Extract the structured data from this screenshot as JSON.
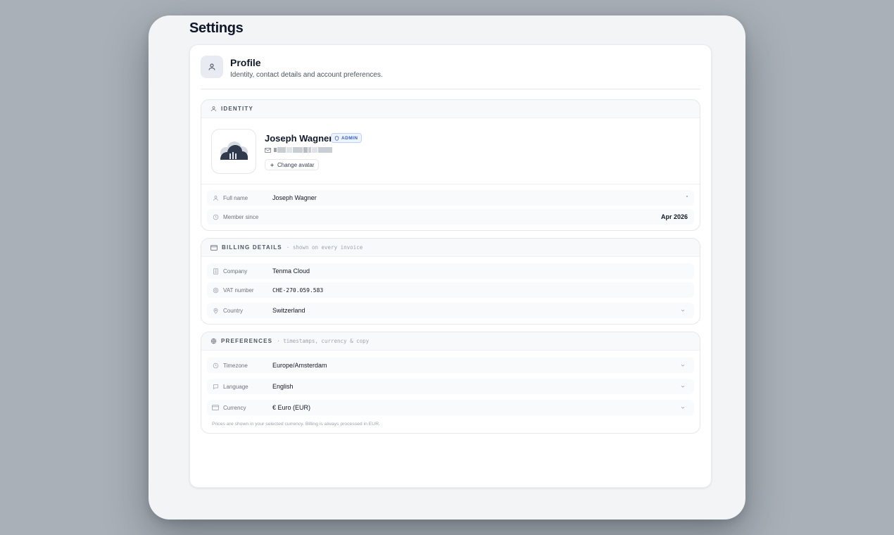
{
  "page": {
    "title": "Settings"
  },
  "profile": {
    "title": "Profile",
    "subtitle": "Identity, contact details and account preferences."
  },
  "identity": {
    "label": "IDENTITY",
    "name": "Joseph Wagner",
    "badge": "ADMIN",
    "change_avatar": "Change avatar",
    "rows": {
      "full_name": {
        "label": "Full name",
        "value": "Joseph Wagner"
      },
      "member_since": {
        "label": "Member since",
        "value": "Apr 2026"
      }
    }
  },
  "billing": {
    "label": "BILLING DETAILS",
    "note": "· shown on every invoice",
    "rows": {
      "company": {
        "label": "Company",
        "value": "Tenma Cloud"
      },
      "vat": {
        "label": "VAT number",
        "value": "CHE-270.059.583"
      },
      "country": {
        "label": "Country",
        "value": "Switzerland"
      }
    }
  },
  "preferences": {
    "label": "PREFERENCES",
    "note": "· timestamps, currency & copy",
    "rows": {
      "timezone": {
        "label": "Timezone",
        "value": "Europe/Amsterdam"
      },
      "language": {
        "label": "Language",
        "value": "English"
      },
      "currency": {
        "label": "Currency",
        "value": "€ Euro (EUR)"
      }
    },
    "footnote": "Prices are shown in your selected currency. Billing is always processed in EUR."
  },
  "icons": {
    "profile": "user-icon",
    "identity": "user-icon",
    "billing": "credit-card-icon",
    "preferences": "globe-icon",
    "email": "mail-icon",
    "change": "plus-icon",
    "full_name": "user-icon",
    "member_since": "clock-icon",
    "company": "building-icon",
    "vat": "badge-icon",
    "country": "map-pin-icon",
    "timezone": "clock-icon",
    "language": "chat-bubble-icon",
    "currency": "credit-card-icon",
    "dropdown": "chevron-down-icon",
    "avatar": "cloud-logo-icon",
    "admin": "shield-icon"
  },
  "colors": {
    "accent": "#2f5fb3",
    "badge_bg": "#eef4ff",
    "background": "#a9b0b8"
  }
}
